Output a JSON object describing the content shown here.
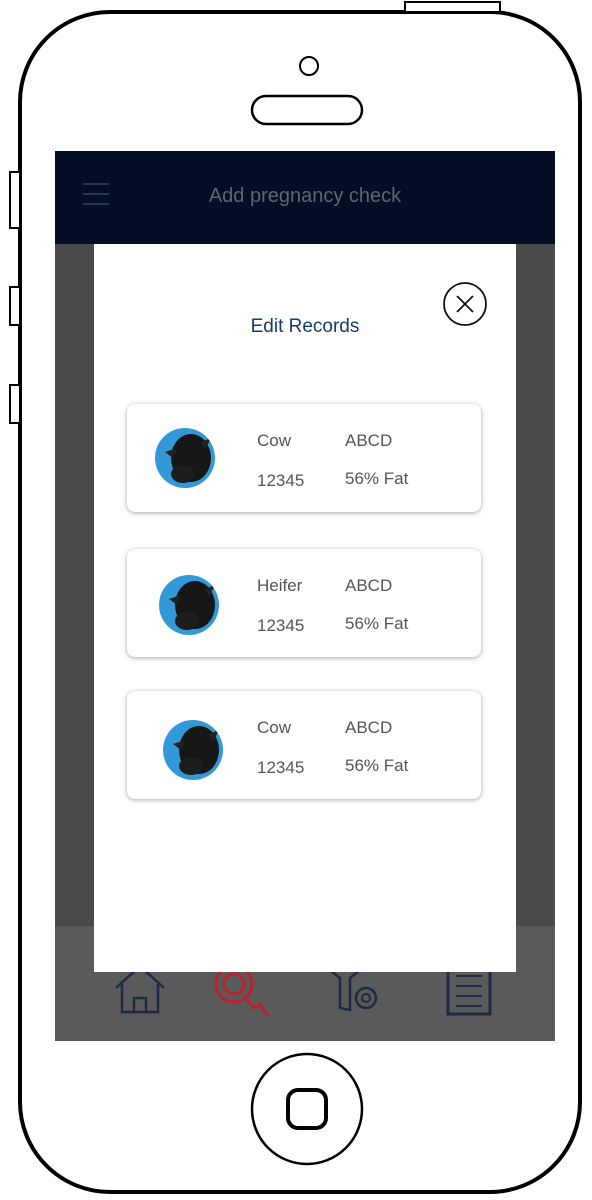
{
  "app_bar": {
    "title": "Add pregnancy check"
  },
  "modal": {
    "title": "Edit Records",
    "records": [
      {
        "type": "Cow",
        "id": "12345",
        "code": "ABCD",
        "fat": "56% Fat"
      },
      {
        "type": "Heifer",
        "id": "12345",
        "code": "ABCD",
        "fat": "56% Fat"
      },
      {
        "type": "Cow",
        "id": "12345",
        "code": "ABCD",
        "fat": "56% Fat"
      }
    ]
  },
  "bottom_nav": {
    "items": [
      {
        "icon": "home-icon"
      },
      {
        "icon": "pregnancy-check-icon"
      },
      {
        "icon": "cattle-settings-icon"
      },
      {
        "icon": "records-list-icon"
      }
    ]
  },
  "colors": {
    "app_bar": "#030e24",
    "title": "#143c6e",
    "avatar_bg": "#3398d8",
    "accent_red": "#b8232b"
  }
}
